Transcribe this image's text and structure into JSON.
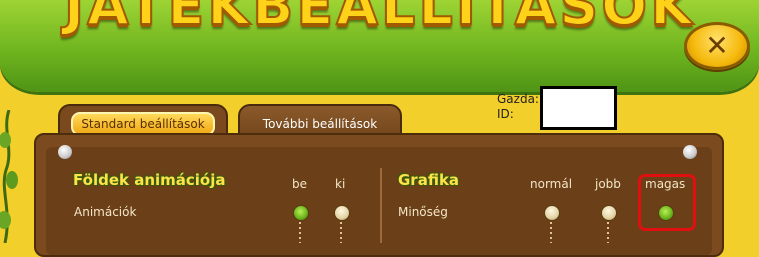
{
  "header": {
    "title": "JÁTÉKBEÁLLÍTÁSOK",
    "close_label": "✕"
  },
  "tabs": [
    {
      "label": "Standard beállítások",
      "active": true
    },
    {
      "label": "További beállítások",
      "active": false
    }
  ],
  "account": {
    "gazda_label": "Gazda:",
    "id_label": "ID:"
  },
  "sections": {
    "animation": {
      "title": "Földek animációja",
      "columns": [
        "be",
        "ki"
      ],
      "row_label": "Animációk",
      "selected": "be"
    },
    "graphics": {
      "title": "Grafika",
      "columns": [
        "normál",
        "jobb",
        "magas"
      ],
      "row_label": "Minőség",
      "selected": "magas"
    }
  },
  "colors": {
    "header_green": "#6fb51f",
    "board_brown": "#6b3f17",
    "highlight_red": "#e01010",
    "title_yellow": "#ffd21a"
  }
}
